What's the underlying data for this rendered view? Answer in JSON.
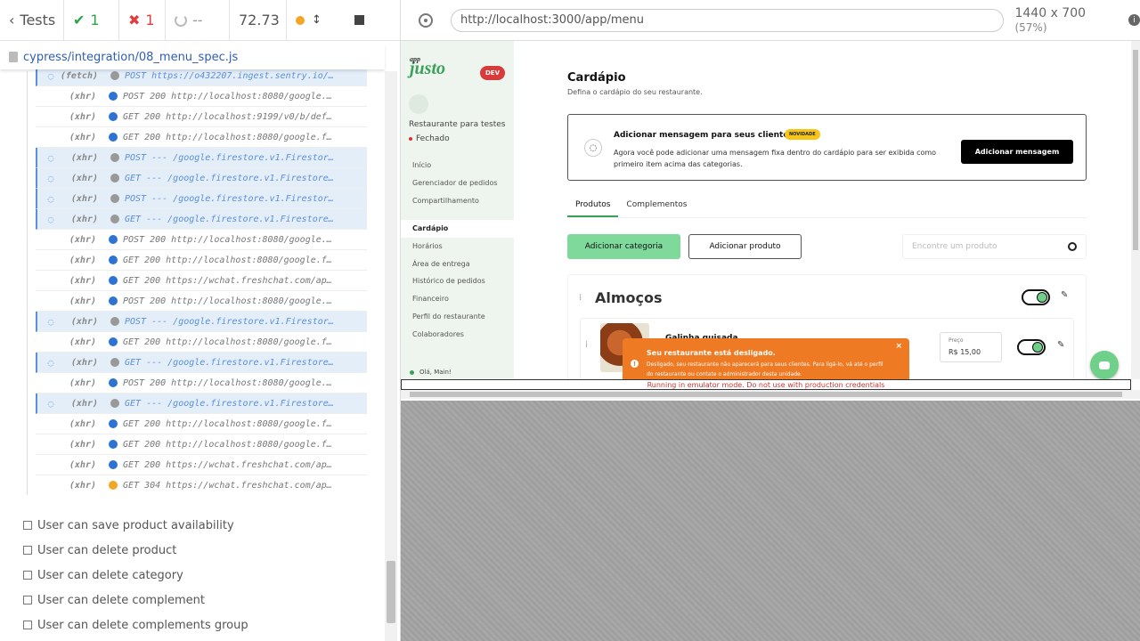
{
  "reporter": {
    "tests_label": "Tests",
    "passed": "1",
    "failed": "1",
    "pending": "--",
    "duration": "72.73",
    "spec_path": "cypress/integration/08_menu_spec.js",
    "commands": [
      {
        "name": "(fetch)",
        "indicator": "grey",
        "pending": true,
        "message": "POST https://o432207.ingest.sentry.io/ap…"
      },
      {
        "name": "(xhr)",
        "indicator": "blue",
        "pending": false,
        "message": "POST 200 http://localhost:8080/google.fir…"
      },
      {
        "name": "(xhr)",
        "indicator": "blue",
        "pending": false,
        "message": "GET 200 http://localhost:9199/v0/b/defaul…"
      },
      {
        "name": "(xhr)",
        "indicator": "blue",
        "pending": false,
        "message": "GET 200 http://localhost:8080/google.fire…"
      },
      {
        "name": "(xhr)",
        "indicator": "grey",
        "pending": true,
        "message": "POST --- /google.firestore.v1.Firestore/Li…"
      },
      {
        "name": "(xhr)",
        "indicator": "grey",
        "pending": true,
        "message": "GET --- /google.firestore.v1.Firestore/Li…"
      },
      {
        "name": "(xhr)",
        "indicator": "grey",
        "pending": true,
        "message": "POST --- /google.firestore.v1.Firestore/Li…"
      },
      {
        "name": "(xhr)",
        "indicator": "grey",
        "pending": true,
        "message": "GET --- /google.firestore.v1.Firestore/Li…"
      },
      {
        "name": "(xhr)",
        "indicator": "blue",
        "pending": false,
        "message": "POST 200 http://localhost:8080/google.fir…"
      },
      {
        "name": "(xhr)",
        "indicator": "blue",
        "pending": false,
        "message": "GET 200 http://localhost:8080/google.fire…"
      },
      {
        "name": "(xhr)",
        "indicator": "blue",
        "pending": false,
        "message": "GET 200 https://wchat.freshchat.com/app/s…"
      },
      {
        "name": "(xhr)",
        "indicator": "blue",
        "pending": false,
        "message": "POST 200 http://localhost:8080/google.fir…"
      },
      {
        "name": "(xhr)",
        "indicator": "grey",
        "pending": true,
        "message": "POST --- /google.firestore.v1.Firestore/Li…"
      },
      {
        "name": "(xhr)",
        "indicator": "blue",
        "pending": false,
        "message": "GET 200 http://localhost:8080/google.fire…"
      },
      {
        "name": "(xhr)",
        "indicator": "grey",
        "pending": true,
        "message": "GET --- /google.firestore.v1.Firestore/Li…"
      },
      {
        "name": "(xhr)",
        "indicator": "blue",
        "pending": false,
        "message": "POST 200 http://localhost:8080/google.fir…"
      },
      {
        "name": "(xhr)",
        "indicator": "grey",
        "pending": true,
        "message": "GET --- /google.firestore.v1.Firestore/Li…"
      },
      {
        "name": "(xhr)",
        "indicator": "blue",
        "pending": false,
        "message": "GET 200 http://localhost:8080/google.fire…"
      },
      {
        "name": "(xhr)",
        "indicator": "blue",
        "pending": false,
        "message": "GET 200 http://localhost:8080/google.fire…"
      },
      {
        "name": "(xhr)",
        "indicator": "blue",
        "pending": false,
        "message": "GET 200 https://wchat.freshchat.com/app/s…"
      },
      {
        "name": "(xhr)",
        "indicator": "orange",
        "pending": false,
        "message": "GET 304 https://wchat.freshchat.com/app/s…"
      }
    ],
    "pending_tests": [
      "User can save product availability",
      "User can delete product",
      "User can delete category",
      "User can delete complement",
      "User can delete complements group"
    ]
  },
  "runner": {
    "url": "http://localhost:3000/app/menu",
    "viewport": "1440 x 700",
    "scale": "(57%)",
    "emulator_warning": "Running in emulator mode. Do not use with production credentials"
  },
  "app": {
    "logo_small": "app",
    "logo": "justo",
    "env_badge": "DEV",
    "restaurant_name": "Restaurante para testes",
    "status": "Fechado",
    "nav_top": [
      "Início",
      "Gerenciador de pedidos",
      "Compartilhamento"
    ],
    "nav_main": [
      "Cardápio",
      "Horários",
      "Área de entrega",
      "Histórico de pedidos",
      "Financeiro",
      "Perfil do restaurante",
      "Colaboradores"
    ],
    "user_greeting": "Olá, Main!",
    "page_title": "Cardápio",
    "page_subtitle": "Defina o cardápio do seu restaurante.",
    "message_card": {
      "title": "Adicionar mensagem para seus clientes",
      "badge": "NOVIDADE",
      "description": "Agora você pode adicionar uma mensagem fixa dentro do cardápio para ser exibida como primeiro item acima das categorias.",
      "button": "Adicionar mensagem"
    },
    "tabs": [
      "Produtos",
      "Complementos"
    ],
    "add_category": "Adicionar categoria",
    "add_product": "Adicionar produto",
    "search_placeholder": "Encontre um produto",
    "category": {
      "name": "Almoços",
      "product_name": "Galinha guisada",
      "price_label": "Preço",
      "price_value": "R$ 15,00"
    },
    "toast": {
      "title": "Seu restaurante está desligado.",
      "description": "Desligado, seu restaurante não aparecerá para seus clientes. Para ligá-lo, vá até o perfil do restaurante ou contate o administrador desta unidade."
    }
  }
}
